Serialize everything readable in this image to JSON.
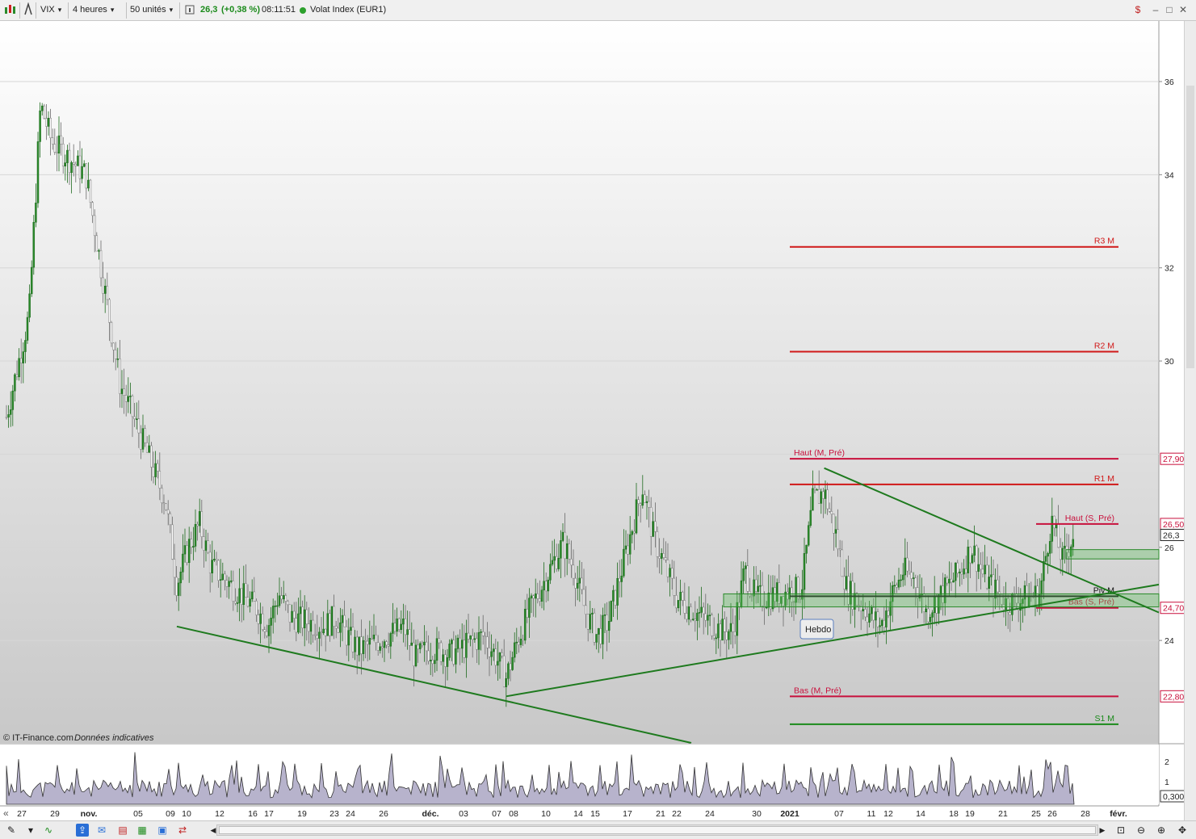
{
  "toolbar": {
    "symbol": "VIX",
    "timeframe": "4 heures",
    "units": "50 unités",
    "price": "26,3",
    "change": "(+0,38 %)",
    "time": "08:11:51",
    "instrument": "Volat Index (EUR1)",
    "price_color": "#1a8a1a",
    "status_dot_color": "#2ca02c"
  },
  "watermark": {
    "source": "© IT-Finance.com",
    "note": "Données indicatives"
  },
  "annotation_box": "Hebdo",
  "price_axis_labels": [
    "36",
    "34",
    "32",
    "30",
    "26",
    "24"
  ],
  "price_tags": [
    "27,900",
    "26,500",
    "26,3",
    "24,700",
    "22,800"
  ],
  "volume_axis_labels": [
    "2",
    "1"
  ],
  "volume_tag": "0,3000",
  "pivot_lines": [
    {
      "label": "R3 M",
      "value": 32.45,
      "color": "#d01818"
    },
    {
      "label": "R2 M",
      "value": 30.2,
      "color": "#d01818"
    },
    {
      "label": "Haut (M, Pré)",
      "value": 27.9,
      "color": "#c8103c"
    },
    {
      "label": "R1 M",
      "value": 27.35,
      "color": "#d01818"
    },
    {
      "label": "Haut (S, Pré)",
      "value": 26.5,
      "color": "#c8103c"
    },
    {
      "label": "Piv M",
      "value": 24.95,
      "color": "#111111"
    },
    {
      "label": "Bas (S, Pré)",
      "value": 24.7,
      "color": "#c8103c"
    },
    {
      "label": "Bas (M, Pré)",
      "value": 22.8,
      "color": "#c8103c"
    },
    {
      "label": "S1 M",
      "value": 22.2,
      "color": "#1a8a1a"
    }
  ],
  "chart_data": {
    "type": "candlestick",
    "title": "",
    "xlabel": "",
    "ylabel": "",
    "ylim": [
      21.8,
      37.3
    ],
    "y_ticks": [
      24,
      26,
      28,
      30,
      32,
      34,
      36
    ],
    "x_tick_labels": [
      "27",
      "29",
      "nov.",
      "05",
      "09",
      "10",
      "12",
      "16",
      "17",
      "19",
      "23",
      "24",
      "26",
      "déc.",
      "03",
      "07",
      "08",
      "10",
      "14",
      "15",
      "17",
      "21",
      "22",
      "24",
      "30",
      "2021",
      "07",
      "11",
      "12",
      "14",
      "18",
      "19",
      "21",
      "25",
      "26",
      "28",
      "févr."
    ],
    "close_path": [
      {
        "date": "2020-10-26",
        "close": 28.8
      },
      {
        "date": "2020-10-28",
        "close": 31.0
      },
      {
        "date": "2020-10-29",
        "close": 35.5
      },
      {
        "date": "2020-10-30",
        "close": 34.7
      },
      {
        "date": "2020-11-02",
        "close": 34.0
      },
      {
        "date": "2020-11-03",
        "close": 32.5
      },
      {
        "date": "2020-11-04",
        "close": 31.0
      },
      {
        "date": "2020-11-05",
        "close": 29.5
      },
      {
        "date": "2020-11-06",
        "close": 28.9
      },
      {
        "date": "2020-11-09",
        "close": 27.0
      },
      {
        "date": "2020-11-10",
        "close": 25.2
      },
      {
        "date": "2020-11-11",
        "close": 26.0
      },
      {
        "date": "2020-11-12",
        "close": 26.5
      },
      {
        "date": "2020-11-13",
        "close": 25.6
      },
      {
        "date": "2020-11-16",
        "close": 24.9
      },
      {
        "date": "2020-11-17",
        "close": 24.7
      },
      {
        "date": "2020-11-18",
        "close": 24.3
      },
      {
        "date": "2020-11-19",
        "close": 25.0
      },
      {
        "date": "2020-11-20",
        "close": 24.5
      },
      {
        "date": "2020-11-23",
        "close": 24.3
      },
      {
        "date": "2020-11-24",
        "close": 24.5
      },
      {
        "date": "2020-11-25",
        "close": 24.1
      },
      {
        "date": "2020-11-26",
        "close": 23.8
      },
      {
        "date": "2020-11-27",
        "close": 23.9
      },
      {
        "date": "2020-11-30",
        "close": 24.3
      },
      {
        "date": "2020-12-01",
        "close": 23.6
      },
      {
        "date": "2020-12-02",
        "close": 23.8
      },
      {
        "date": "2020-12-03",
        "close": 23.8
      },
      {
        "date": "2020-12-04",
        "close": 23.7
      },
      {
        "date": "2020-12-07",
        "close": 24.1
      },
      {
        "date": "2020-12-08",
        "close": 23.7
      },
      {
        "date": "2020-12-09",
        "close": 23.2
      },
      {
        "date": "2020-12-10",
        "close": 24.0
      },
      {
        "date": "2020-12-11",
        "close": 24.6
      },
      {
        "date": "2020-12-14",
        "close": 26.1
      },
      {
        "date": "2020-12-15",
        "close": 25.5
      },
      {
        "date": "2020-12-16",
        "close": 24.6
      },
      {
        "date": "2020-12-17",
        "close": 24.1
      },
      {
        "date": "2020-12-18",
        "close": 24.4
      },
      {
        "date": "2020-12-21",
        "close": 27.3
      },
      {
        "date": "2020-12-22",
        "close": 26.2
      },
      {
        "date": "2020-12-23",
        "close": 25.6
      },
      {
        "date": "2020-12-24",
        "close": 24.9
      },
      {
        "date": "2020-12-28",
        "close": 24.2
      },
      {
        "date": "2020-12-29",
        "close": 24.2
      },
      {
        "date": "2020-12-30",
        "close": 25.5
      },
      {
        "date": "2020-12-31",
        "close": 24.9
      },
      {
        "date": "2021-01-04",
        "close": 25.1
      },
      {
        "date": "2021-01-05",
        "close": 27.0
      },
      {
        "date": "2021-01-06",
        "close": 27.2
      },
      {
        "date": "2021-01-07",
        "close": 26.3
      },
      {
        "date": "2021-01-08",
        "close": 25.1
      },
      {
        "date": "2021-01-11",
        "close": 24.3
      },
      {
        "date": "2021-01-12",
        "close": 25.0
      },
      {
        "date": "2021-01-13",
        "close": 25.5
      },
      {
        "date": "2021-01-14",
        "close": 25.3
      },
      {
        "date": "2021-01-15",
        "close": 24.6
      },
      {
        "date": "2021-01-18",
        "close": 25.5
      },
      {
        "date": "2021-01-19",
        "close": 26.0
      },
      {
        "date": "2021-01-20",
        "close": 25.4
      },
      {
        "date": "2021-01-21",
        "close": 25.1
      },
      {
        "date": "2021-01-22",
        "close": 24.8
      },
      {
        "date": "2021-01-25",
        "close": 25.0
      },
      {
        "date": "2021-01-26",
        "close": 26.6
      },
      {
        "date": "2021-01-27",
        "close": 25.7
      },
      {
        "date": "2021-01-28",
        "close": 26.3
      }
    ]
  }
}
